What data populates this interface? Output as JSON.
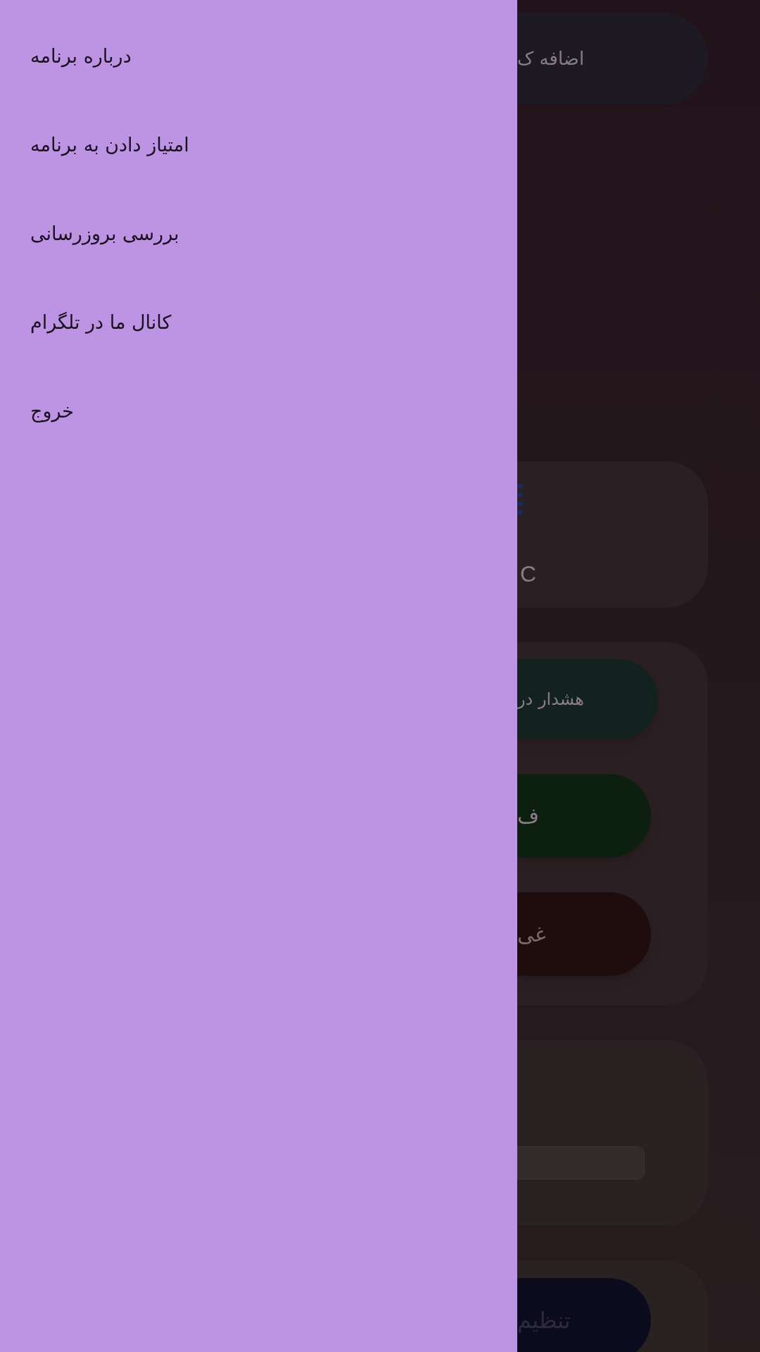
{
  "drawer": {
    "items": [
      {
        "label": "درباره برنامه"
      },
      {
        "label": "امتیاز دادن به برنامه"
      },
      {
        "label": "بررسی بروزرسانی"
      },
      {
        "label": "کانال ما در تلگرام"
      },
      {
        "label": "خروج"
      }
    ]
  },
  "background": {
    "top_button": {
      "label": "اضافه ک"
    },
    "status_card": {
      "label": "C"
    },
    "action_buttons": [
      {
        "label": "هشدار در",
        "color": "#13221f"
      },
      {
        "label": "ف",
        "color": "#0d200f"
      },
      {
        "label": "غی",
        "color": "#1f0d0d"
      }
    ],
    "bottom_button": {
      "label": "تنظیم"
    }
  }
}
